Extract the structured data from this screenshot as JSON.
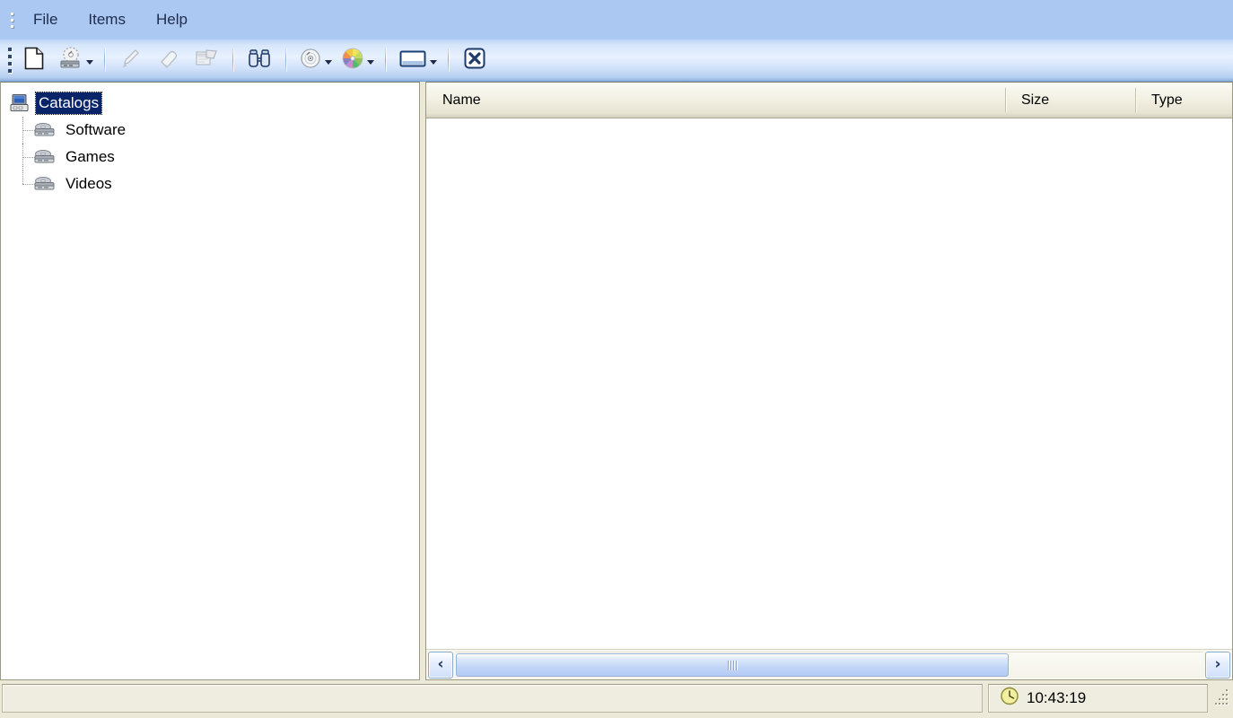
{
  "window": {
    "title": "Catalogs"
  },
  "menubar": {
    "grip": "drag-handle",
    "items": [
      {
        "label": "File"
      },
      {
        "label": "Items"
      },
      {
        "label": "Help"
      }
    ]
  },
  "toolbar": {
    "buttons": [
      {
        "name": "new-catalog",
        "icon": "new-document-icon",
        "label": "New",
        "has_dropdown": false,
        "enabled": true
      },
      {
        "name": "scan-disc",
        "icon": "disc-scan-icon",
        "label": "Scan disc",
        "has_dropdown": true,
        "enabled": true
      },
      {
        "name": "edit-item",
        "icon": "pencil-icon",
        "label": "Edit",
        "has_dropdown": false,
        "enabled": false
      },
      {
        "name": "delete-item",
        "icon": "eraser-icon",
        "label": "Delete",
        "has_dropdown": false,
        "enabled": false
      },
      {
        "name": "properties",
        "icon": "folder-properties-icon",
        "label": "Properties",
        "has_dropdown": false,
        "enabled": false
      },
      {
        "name": "find",
        "icon": "binoculars-icon",
        "label": "Find",
        "has_dropdown": false,
        "enabled": true
      },
      {
        "name": "disc-tools",
        "icon": "cd-disc-icon",
        "label": "Disc",
        "has_dropdown": true,
        "enabled": true
      },
      {
        "name": "categories",
        "icon": "color-wheel-icon",
        "label": "Categories",
        "has_dropdown": true,
        "enabled": true
      },
      {
        "name": "view-mode",
        "icon": "window-view-icon",
        "label": "View",
        "has_dropdown": true,
        "enabled": true
      },
      {
        "name": "close",
        "icon": "close-x-icon",
        "label": "Close",
        "has_dropdown": false,
        "enabled": true
      }
    ]
  },
  "tree": {
    "root": {
      "label": "Catalogs",
      "icon": "computer-icon",
      "selected": true,
      "expanded": true
    },
    "children": [
      {
        "label": "Software",
        "icon": "disc-drive-icon",
        "selected": false
      },
      {
        "label": "Games",
        "icon": "disc-drive-icon",
        "selected": false
      },
      {
        "label": "Videos",
        "icon": "disc-drive-icon",
        "selected": false
      }
    ]
  },
  "list": {
    "columns": [
      {
        "label": "Name",
        "key": "name"
      },
      {
        "label": "Size",
        "key": "size"
      },
      {
        "label": "Type",
        "key": "type"
      }
    ],
    "rows": [],
    "empty": true
  },
  "hscrollbar": {
    "left_button": "‹",
    "right_button": "›",
    "thumb_ratio": 0.74
  },
  "statusbar": {
    "message": "",
    "clock": "10:43:19",
    "clock_icon": "clock-icon",
    "resize_grip": "resize-grip"
  },
  "colors": {
    "menubar": "#aac8f2",
    "toolbar_top": "#bcd4f5",
    "toolbar_mid": "#e8f1fe",
    "toolbar_bottom": "#8fb3e2",
    "selection": "#0a246a",
    "panel_chrome": "#ece9d8",
    "header_face": "#f3f1e4",
    "scroll_thumb": "#c3d6f7",
    "clock_face": "#f3f0a0"
  }
}
